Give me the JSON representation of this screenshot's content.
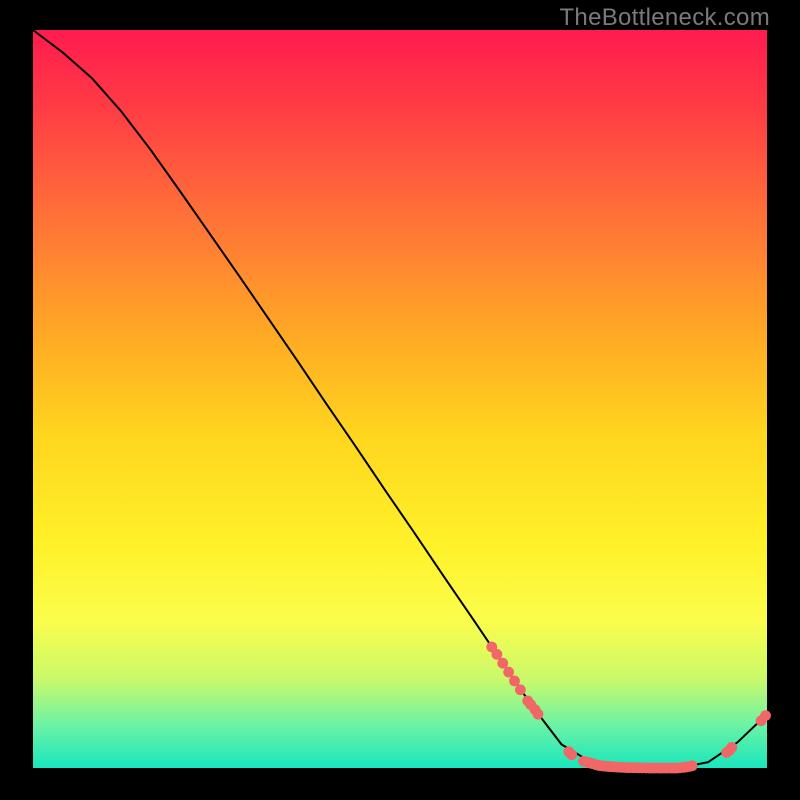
{
  "watermark": "TheBottleneck.com",
  "colors": {
    "curve": "#000000",
    "dots": "#f16666",
    "plot_border": "#000000"
  },
  "chart_data": {
    "type": "line",
    "title": "",
    "xlabel": "",
    "ylabel": "",
    "xlim": [
      0,
      100
    ],
    "ylim": [
      0,
      100
    ],
    "grid": false,
    "legend": false,
    "series": [
      {
        "name": "bottleneck-curve",
        "x": [
          0,
          4,
          8,
          12,
          16,
          20,
          24,
          28,
          32,
          36,
          40,
          44,
          48,
          52,
          56,
          60,
          64,
          68,
          72,
          76,
          80,
          84,
          88,
          92,
          96,
          100
        ],
        "y": [
          100,
          97,
          93.5,
          89,
          83.8,
          78.2,
          72.5,
          66.8,
          61,
          55.2,
          49.3,
          43.5,
          37.6,
          31.8,
          25.9,
          20.1,
          14.2,
          8.4,
          3.2,
          0.8,
          0,
          0,
          0,
          0.8,
          3.5,
          7.3
        ]
      }
    ],
    "dot_markers": {
      "name": "highlighted-points",
      "points": [
        {
          "x": 62.5,
          "y": 16.4
        },
        {
          "x": 63.2,
          "y": 15.4
        },
        {
          "x": 64.0,
          "y": 14.2
        },
        {
          "x": 64.8,
          "y": 13.0
        },
        {
          "x": 65.6,
          "y": 11.8
        },
        {
          "x": 66.4,
          "y": 10.6
        },
        {
          "x": 67.4,
          "y": 9.1
        },
        {
          "x": 67.8,
          "y": 8.6
        },
        {
          "x": 68.4,
          "y": 7.9
        },
        {
          "x": 68.8,
          "y": 7.3
        },
        {
          "x": 73.0,
          "y": 2.2
        },
        {
          "x": 73.4,
          "y": 1.8
        },
        {
          "x": 75.0,
          "y": 0.9
        },
        {
          "x": 75.4,
          "y": 0.8
        },
        {
          "x": 75.8,
          "y": 0.7
        },
        {
          "x": 76.2,
          "y": 0.6
        },
        {
          "x": 76.7,
          "y": 0.45
        },
        {
          "x": 77.1,
          "y": 0.35
        },
        {
          "x": 77.5,
          "y": 0.3
        },
        {
          "x": 77.9,
          "y": 0.25
        },
        {
          "x": 78.4,
          "y": 0.2
        },
        {
          "x": 78.8,
          "y": 0.18
        },
        {
          "x": 79.2,
          "y": 0.15
        },
        {
          "x": 79.6,
          "y": 0.12
        },
        {
          "x": 80.1,
          "y": 0.1
        },
        {
          "x": 80.5,
          "y": 0.08
        },
        {
          "x": 80.9,
          "y": 0.06
        },
        {
          "x": 81.3,
          "y": 0.05
        },
        {
          "x": 81.8,
          "y": 0.04
        },
        {
          "x": 82.2,
          "y": 0.03
        },
        {
          "x": 82.6,
          "y": 0.02
        },
        {
          "x": 83.0,
          "y": 0.02
        },
        {
          "x": 83.5,
          "y": 0.01
        },
        {
          "x": 83.9,
          "y": 0.01
        },
        {
          "x": 84.3,
          "y": 0.0
        },
        {
          "x": 84.7,
          "y": 0.0
        },
        {
          "x": 85.2,
          "y": 0.0
        },
        {
          "x": 85.6,
          "y": 0.0
        },
        {
          "x": 86.0,
          "y": 0.0
        },
        {
          "x": 86.4,
          "y": 0.0
        },
        {
          "x": 86.9,
          "y": 0.0
        },
        {
          "x": 87.3,
          "y": 0.0
        },
        {
          "x": 87.7,
          "y": 0.0
        },
        {
          "x": 88.1,
          "y": 0.03
        },
        {
          "x": 88.6,
          "y": 0.08
        },
        {
          "x": 89.0,
          "y": 0.14
        },
        {
          "x": 89.4,
          "y": 0.22
        },
        {
          "x": 89.8,
          "y": 0.3
        },
        {
          "x": 94.5,
          "y": 2.1
        },
        {
          "x": 94.9,
          "y": 2.4
        },
        {
          "x": 95.2,
          "y": 2.8
        },
        {
          "x": 99.2,
          "y": 6.4
        },
        {
          "x": 99.8,
          "y": 7.1
        }
      ]
    }
  }
}
